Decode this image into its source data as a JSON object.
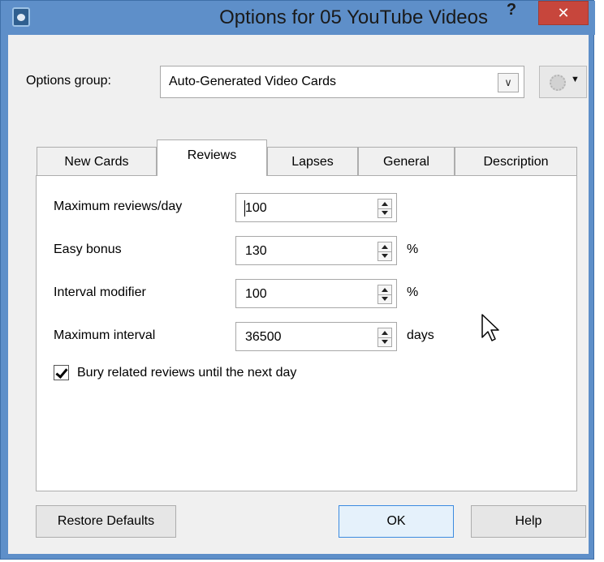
{
  "window": {
    "title": "Options for 05 YouTube Videos",
    "help_label": "?",
    "close_label": "✕"
  },
  "options_group": {
    "label": "Options group:",
    "value": "Auto-Generated Video Cards",
    "dropdown_icon": "chevron-down-icon",
    "gear_icon": "gear-icon",
    "gear_caret": "▼"
  },
  "tabs": [
    {
      "label": "New Cards"
    },
    {
      "label": "Reviews"
    },
    {
      "label": "Lapses"
    },
    {
      "label": "General"
    },
    {
      "label": "Description"
    }
  ],
  "active_tab": "Reviews",
  "reviews": {
    "fields": [
      {
        "label": "Maximum reviews/day",
        "value": "100",
        "suffix": ""
      },
      {
        "label": "Easy bonus",
        "value": "130",
        "suffix": "%"
      },
      {
        "label": "Interval modifier",
        "value": "100",
        "suffix": "%"
      },
      {
        "label": "Maximum interval",
        "value": "36500",
        "suffix": "days"
      }
    ],
    "bury_label": "Bury related reviews until the next day",
    "bury_checked": true
  },
  "buttons": {
    "restore": "Restore Defaults",
    "ok": "OK",
    "help": "Help"
  },
  "colors": {
    "title_bar": "#5e8fc9",
    "close_button": "#c7463c",
    "default_button_border": "#3c8be0"
  }
}
